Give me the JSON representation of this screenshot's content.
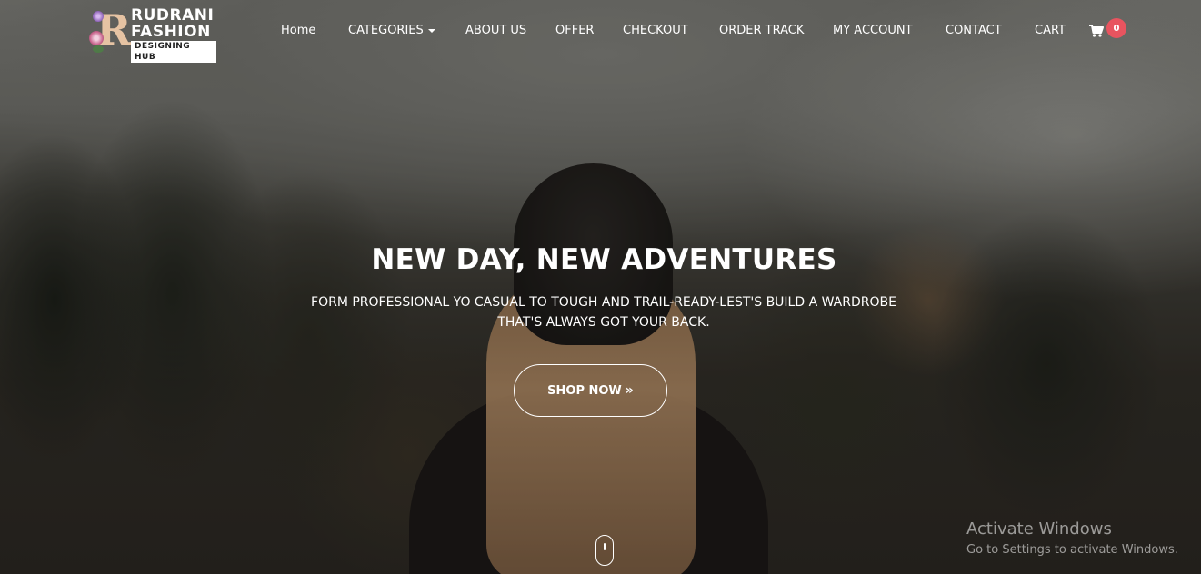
{
  "brand": {
    "logo_letter": "R",
    "name_line1": "RUDRANI",
    "name_line2": "FASHION",
    "tagline": "DESIGNING HUB"
  },
  "nav": {
    "items": [
      {
        "label": "Home"
      },
      {
        "label": "CATEGORIES",
        "has_dropdown": true
      },
      {
        "label": "ABOUT US"
      },
      {
        "label": "OFFER"
      },
      {
        "label": "CHECKOUT"
      },
      {
        "label": "ORDER TRACK"
      },
      {
        "label": "MY ACCOUNT"
      },
      {
        "label": "CONTACT"
      },
      {
        "label": "CART"
      }
    ],
    "cart_icon": "shopping-cart-icon",
    "cart_count": "0"
  },
  "hero": {
    "title": "NEW DAY, NEW ADVENTURES",
    "subtitle": "FORM PROFESSIONAL YO CASUAL TO TOUGH AND TRAIL-READY-LEST'S BUILD A WARDROBE THAT'S ALWAYS GOT YOUR BACK.",
    "cta_label": "SHOP NOW",
    "cta_icon": "double-chevron-right-icon",
    "scroll_icon": "mouse-scroll-icon"
  },
  "os_watermark": {
    "line1": "Activate Windows",
    "line2": "Go to Settings to activate Windows."
  },
  "colors": {
    "badge": "#e8545f",
    "text": "#ffffff"
  }
}
